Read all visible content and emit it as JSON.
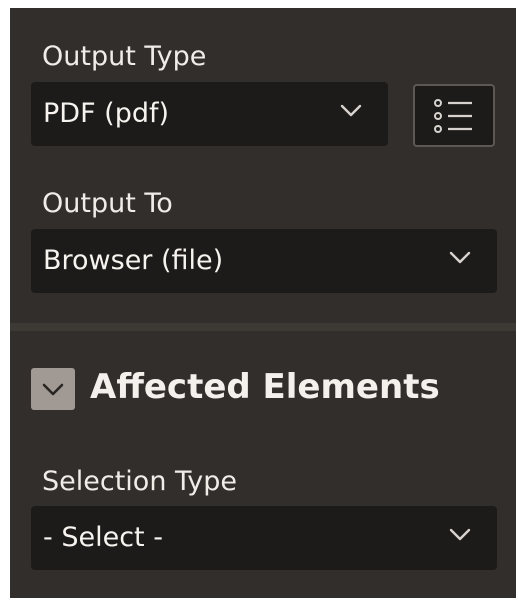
{
  "report_settings": {
    "output_type_label": "Output Type",
    "output_type_value": "PDF (pdf)",
    "output_to_label": "Output To",
    "output_to_value": "Browser (file)"
  },
  "affected_elements": {
    "title": "Affected Elements",
    "selection_type_label": "Selection Type",
    "selection_type_value": "- Select -"
  },
  "icons": {
    "output_type_chevron": "chevron-down-icon",
    "output_to_chevron": "chevron-down-icon",
    "selection_type_chevron": "chevron-down-icon",
    "list_button": "list-view-icon",
    "section_toggle": "chevron-down-icon"
  },
  "colors": {
    "panel_background": "#322e2b",
    "field_background": "#1d1b1a",
    "text": "#f0ece8",
    "toggle_background": "#a19a94"
  }
}
